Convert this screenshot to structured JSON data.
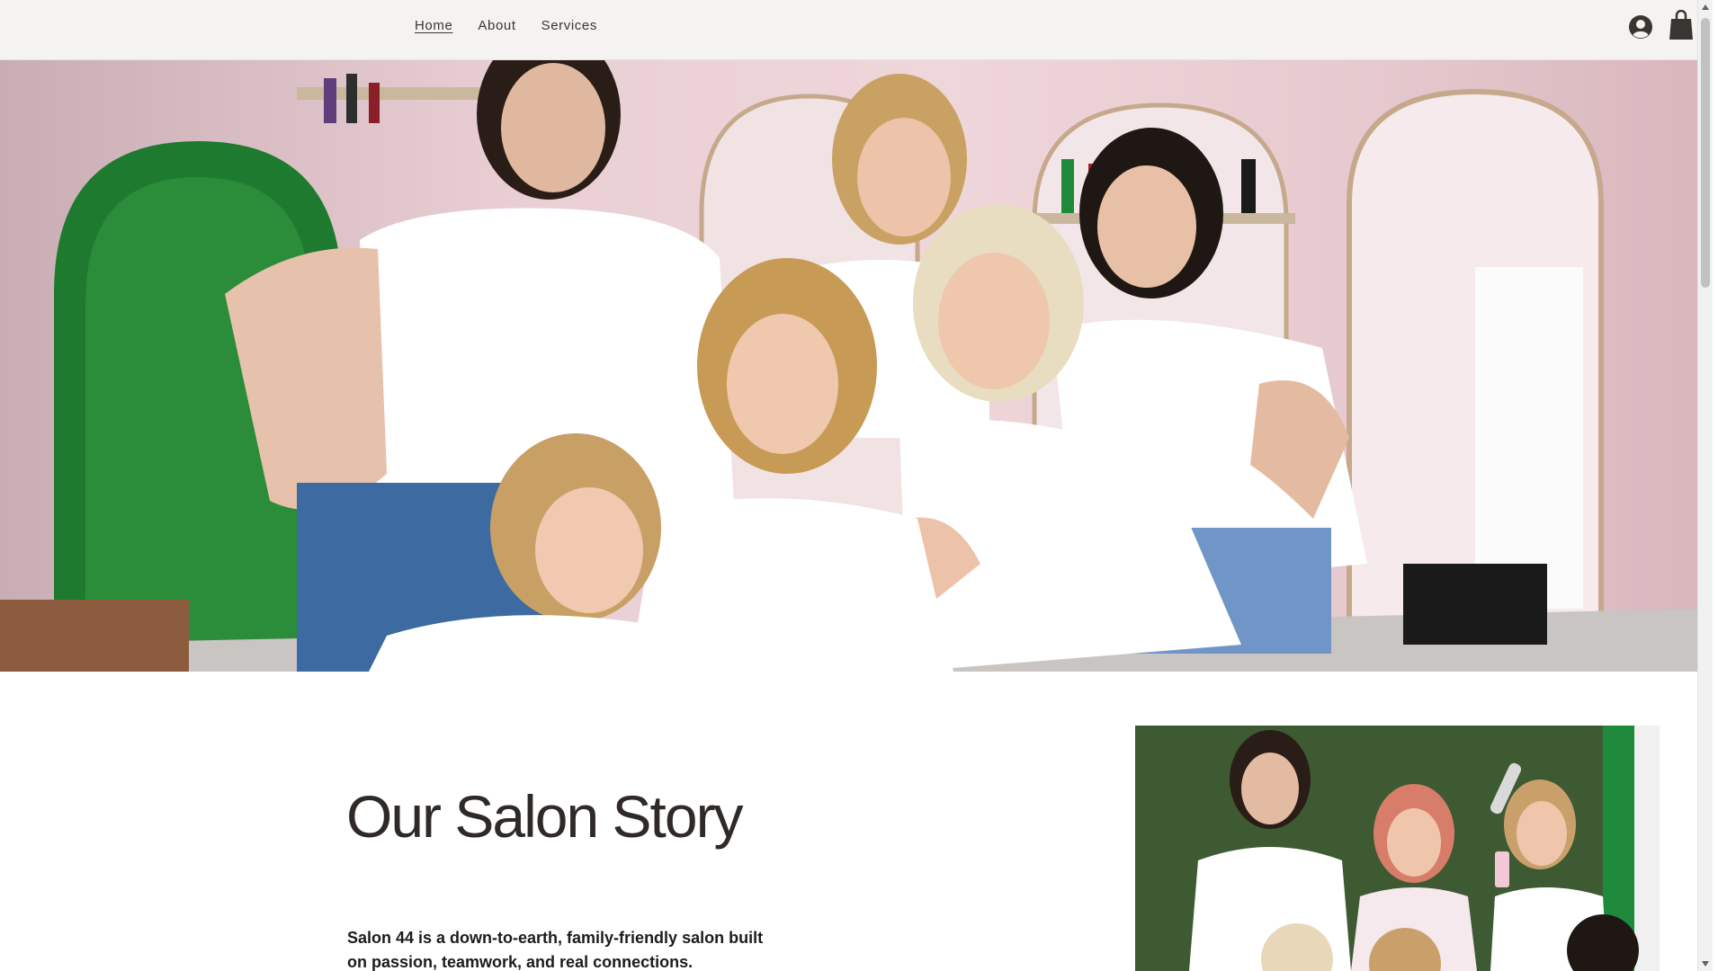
{
  "nav": {
    "items": [
      {
        "label": "Home",
        "active": true
      },
      {
        "label": "About",
        "active": false
      },
      {
        "label": "Services",
        "active": false
      }
    ]
  },
  "icons": {
    "account": "account-icon",
    "cart": "shopping-bag-icon"
  },
  "colors": {
    "header_bg": "#f4f3f1",
    "nav_text": "#3b3530",
    "title_text": "#2f2a27",
    "body_text": "#1e1c1a",
    "hero_wall_pink": "#efd6da"
  },
  "story": {
    "title": "Our Salon Story",
    "paragraph": "Salon 44 is a down-to-earth, family-friendly salon built on passion, teamwork, and real connections."
  }
}
